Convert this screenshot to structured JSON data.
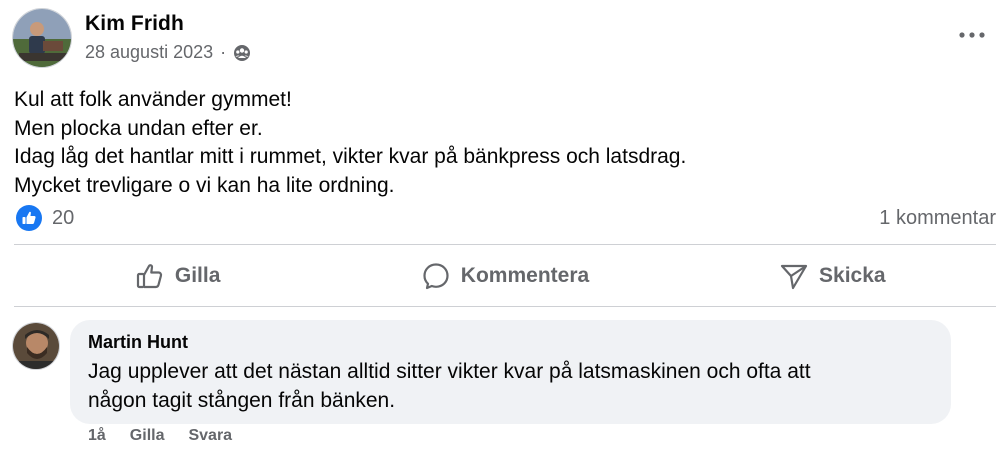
{
  "post": {
    "author": "Kim Fridh",
    "date": "28 augusti 2023",
    "separator": "·",
    "privacy_icon": "group-icon",
    "menu_icon": "more-options-icon",
    "body_lines": [
      "Kul att folk använder gymmet!",
      "Men plocka undan efter er.",
      "Idag låg det hantlar mitt i rummet, vikter kvar på bänkpress och latsdrag.",
      "Mycket trevligare o vi kan ha lite ordning."
    ]
  },
  "stats": {
    "reaction_icon": "like-reaction-icon",
    "reaction_count": "20",
    "comment_count": "1 kommentar"
  },
  "actions": {
    "like": "Gilla",
    "comment": "Kommentera",
    "send": "Skicka"
  },
  "comment": {
    "author": "Martin Hunt",
    "text_lines": [
      "Jag upplever att det nästan alltid sitter vikter kvar på latsmaskinen och ofta att",
      "någon tagit stången från bänken."
    ],
    "age": "1å",
    "like": "Gilla",
    "reply": "Svara"
  },
  "colors": {
    "accent": "#1877f2",
    "secondary_text": "#65676b",
    "bubble": "#f0f2f5",
    "divider": "#ced0d4"
  }
}
